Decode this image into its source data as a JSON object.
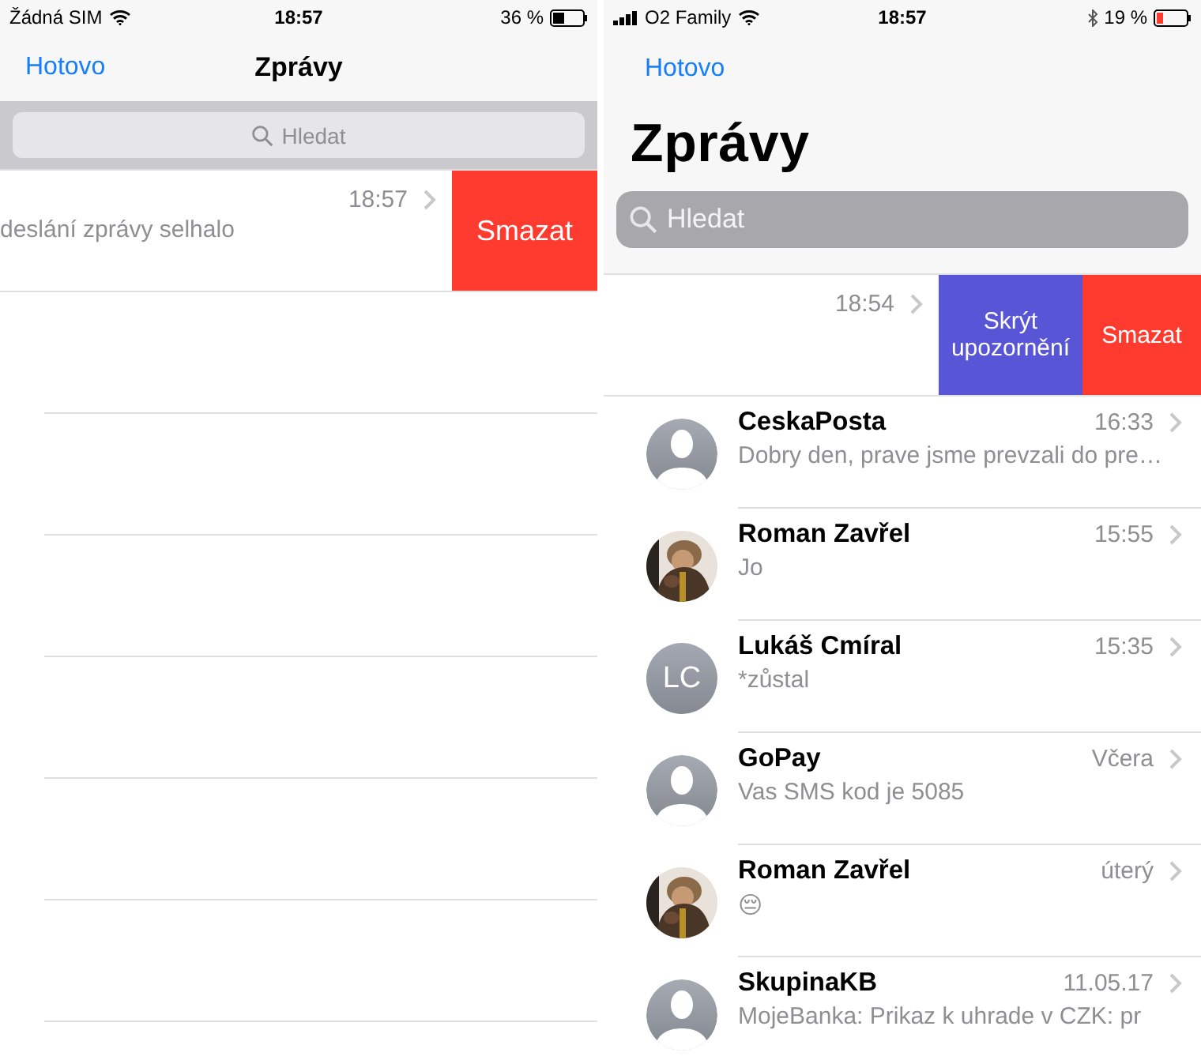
{
  "panels": [
    {
      "status_bar": {
        "carrier": "Žádná SIM",
        "signal": false,
        "time": "18:57",
        "bluetooth": false,
        "battery": "36 %",
        "battery_low": false
      },
      "nav": {
        "done": "Hotovo",
        "title": "Zprávy",
        "large_title": false
      },
      "search": {
        "placeholder": "Hledat"
      },
      "swiped_row": {
        "preview": "deslání zprávy selhalo",
        "time": "18:57",
        "actions": [
          {
            "kind": "delete",
            "label": "Smazat"
          }
        ]
      }
    },
    {
      "status_bar": {
        "carrier": "O2 Family",
        "signal": true,
        "time": "18:57",
        "bluetooth": true,
        "battery": "19 %",
        "battery_low": true
      },
      "nav": {
        "done": "Hotovo",
        "title": "Zprávy",
        "large_title": true
      },
      "search": {
        "placeholder": "Hledat"
      },
      "swiped_row": {
        "time": "18:54",
        "actions": [
          {
            "kind": "hide",
            "label": "Skrýt upozornění"
          },
          {
            "kind": "delete",
            "label": "Smazat"
          }
        ]
      },
      "conversations": [
        {
          "avatar": {
            "kind": "silhouette"
          },
          "name": "CeskaPosta",
          "time": "16:33",
          "preview": "Dobry den, prave jsme prevzali do pre…"
        },
        {
          "name": "Roman Zavřel",
          "time": "15:55",
          "preview": "Jo"
        },
        {
          "avatar": {
            "kind": "initials",
            "initials": "LC"
          },
          "name": "Lukáš Cmíral",
          "time": "15:35",
          "preview": "*zůstal"
        },
        {
          "avatar": {
            "kind": "silhouette"
          },
          "name": "GoPay",
          "time": "Včera",
          "preview": "Vas SMS kod je 5085"
        },
        {
          "name": "Roman Zavřel",
          "time": "úterý",
          "preview": "😔"
        },
        {
          "avatar": {
            "kind": "silhouette"
          },
          "name": "SkupinaKB",
          "time": "11.05.17",
          "preview": "MojeBanka: Prikaz k uhrade v CZK: pr"
        }
      ]
    }
  ]
}
